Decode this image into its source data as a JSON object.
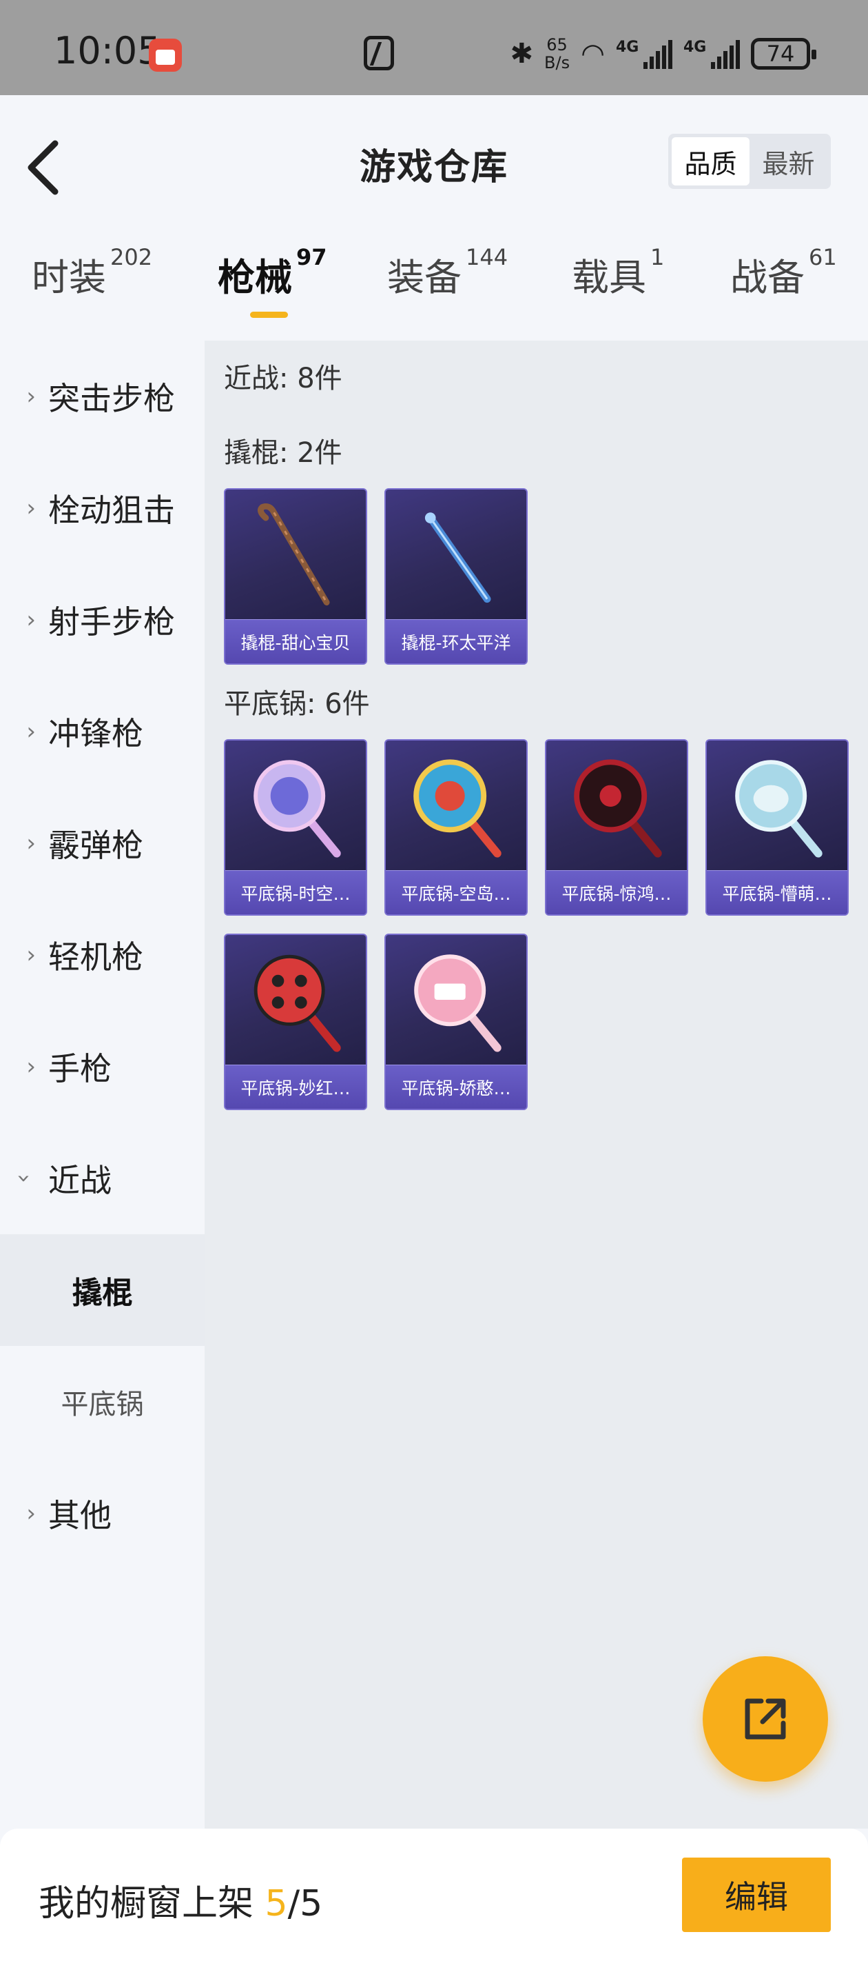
{
  "status_bar": {
    "time": "10:05",
    "net_speed_value": "65",
    "net_speed_unit": "B/s",
    "signal1_label": "4G",
    "signal2_label": "4G",
    "battery": "74"
  },
  "header": {
    "title": "游戏仓库",
    "sort_options": [
      "品质",
      "最新"
    ],
    "sort_selected": "品质"
  },
  "tabs": [
    {
      "label": "时装",
      "count": "202"
    },
    {
      "label": "枪械",
      "count": "97",
      "active": true
    },
    {
      "label": "装备",
      "count": "144"
    },
    {
      "label": "载具",
      "count": "1"
    },
    {
      "label": "战备",
      "count": "61"
    }
  ],
  "sidebar": {
    "items": [
      {
        "label": "突击步枪"
      },
      {
        "label": "栓动狙击"
      },
      {
        "label": "射手步枪"
      },
      {
        "label": "冲锋枪"
      },
      {
        "label": "霰弹枪"
      },
      {
        "label": "轻机枪"
      },
      {
        "label": "手枪"
      },
      {
        "label": "近战",
        "expanded": true
      },
      {
        "label": "撬棍",
        "sub": true,
        "active": true
      },
      {
        "label": "平底锅",
        "sub": true
      },
      {
        "label": "其他"
      }
    ]
  },
  "content": {
    "section_title": "近战: 8件",
    "groups": [
      {
        "title": "撬棍: 2件",
        "items": [
          {
            "label": "撬棍-甜心宝贝",
            "icon": "crowbar-brown-icon"
          },
          {
            "label": "撬棍-环太平洋",
            "icon": "crowbar-blue-icon"
          }
        ]
      },
      {
        "title": "平底锅: 6件",
        "items": [
          {
            "label": "平底锅-时空…",
            "icon": "pan-purple-icon"
          },
          {
            "label": "平底锅-空岛…",
            "icon": "pan-colorful-icon"
          },
          {
            "label": "平底锅-惊鸿…",
            "icon": "pan-red-black-icon"
          },
          {
            "label": "平底锅-懵萌…",
            "icon": "pan-lightblue-icon"
          },
          {
            "label": "平底锅-妙红…",
            "icon": "pan-ladybug-icon"
          },
          {
            "label": "平底锅-娇憨…",
            "icon": "pan-pink-icon"
          }
        ]
      }
    ]
  },
  "bottom_bar": {
    "prefix": "我的橱窗上架 ",
    "current": "5",
    "separator": "/",
    "total": "5",
    "edit_label": "编辑"
  },
  "colors": {
    "accent": "#f8ae1a",
    "card_bg": "#2f2a5a",
    "card_label": "#5548b0"
  }
}
